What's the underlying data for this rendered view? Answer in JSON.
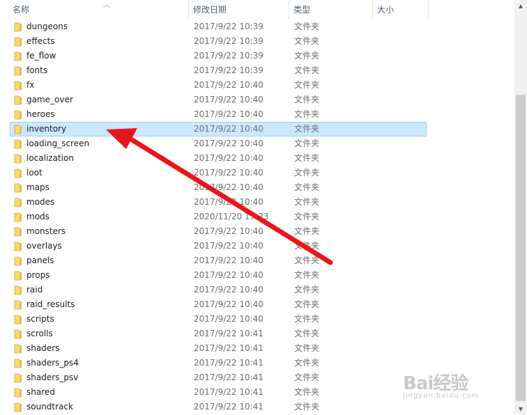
{
  "columns": {
    "name": "名称",
    "date": "修改日期",
    "type": "类型",
    "size": "大小"
  },
  "sort_icon": "chevron-up-icon",
  "rows": [
    {
      "name": "dungeons",
      "date": "2017/9/22 10:39",
      "type": "文件夹"
    },
    {
      "name": "effects",
      "date": "2017/9/22 10:39",
      "type": "文件夹"
    },
    {
      "name": "fe_flow",
      "date": "2017/9/22 10:39",
      "type": "文件夹"
    },
    {
      "name": "fonts",
      "date": "2017/9/22 10:39",
      "type": "文件夹"
    },
    {
      "name": "fx",
      "date": "2017/9/22 10:40",
      "type": "文件夹"
    },
    {
      "name": "game_over",
      "date": "2017/9/22 10:40",
      "type": "文件夹"
    },
    {
      "name": "heroes",
      "date": "2017/9/22 10:40",
      "type": "文件夹"
    },
    {
      "name": "inventory",
      "date": "2017/9/22 10:40",
      "type": "文件夹",
      "selected": true
    },
    {
      "name": "loading_screen",
      "date": "2017/9/22 10:40",
      "type": "文件夹"
    },
    {
      "name": "localization",
      "date": "2017/9/22 10:40",
      "type": "文件夹"
    },
    {
      "name": "loot",
      "date": "2017/9/22 10:40",
      "type": "文件夹"
    },
    {
      "name": "maps",
      "date": "2017/9/22 10:40",
      "type": "文件夹"
    },
    {
      "name": "modes",
      "date": "2017/9/22 10:40",
      "type": "文件夹"
    },
    {
      "name": "mods",
      "date": "2020/11/20 17:23",
      "type": "文件夹"
    },
    {
      "name": "monsters",
      "date": "2017/9/22 10:40",
      "type": "文件夹"
    },
    {
      "name": "overlays",
      "date": "2017/9/22 10:40",
      "type": "文件夹"
    },
    {
      "name": "panels",
      "date": "2017/9/22 10:40",
      "type": "文件夹"
    },
    {
      "name": "props",
      "date": "2017/9/22 10:40",
      "type": "文件夹"
    },
    {
      "name": "raid",
      "date": "2017/9/22 10:40",
      "type": "文件夹"
    },
    {
      "name": "raid_results",
      "date": "2017/9/22 10:40",
      "type": "文件夹"
    },
    {
      "name": "scripts",
      "date": "2017/9/22 10:40",
      "type": "文件夹"
    },
    {
      "name": "scrolls",
      "date": "2017/9/22 10:41",
      "type": "文件夹"
    },
    {
      "name": "shaders",
      "date": "2017/9/22 10:41",
      "type": "文件夹"
    },
    {
      "name": "shaders_ps4",
      "date": "2017/9/22 10:41",
      "type": "文件夹"
    },
    {
      "name": "shaders_psv",
      "date": "2017/9/22 10:41",
      "type": "文件夹"
    },
    {
      "name": "shared",
      "date": "2017/9/22 10:41",
      "type": "文件夹"
    },
    {
      "name": "soundtrack",
      "date": "2017/9/22 10:41",
      "type": "文件夹"
    }
  ],
  "annotation": {
    "arrow_color": "#e8161b",
    "points_to": "inventory"
  },
  "colors": {
    "selection_fill": "#cce8ff",
    "selection_border": "#99d1ff",
    "folder": "#f8d775",
    "header_text": "#4c607a"
  },
  "watermark": {
    "logo": "Bai经验",
    "sub": "jingyan.baidu.com"
  }
}
